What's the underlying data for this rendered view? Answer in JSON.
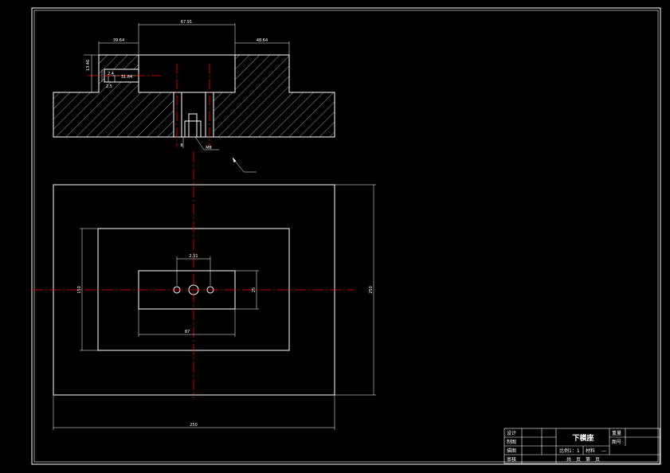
{
  "drawing": {
    "colors": {
      "background": "#000000",
      "line": "#ffffff",
      "centerline": "#ff0000"
    },
    "section_dims": {
      "top_width": "67.91",
      "left_shoulder": "39.64",
      "right_shoulder": "48.64",
      "left_height": "13.46",
      "pocket_depth": "31.64",
      "pocket_small": "2.4",
      "pocket_small_2": "2.5",
      "hole_small": "8",
      "thread_label": "M8"
    },
    "plan_dims": {
      "hole_spacing": "2.51",
      "inner_width": "87",
      "inner_height": "25",
      "middle_height": "150",
      "outer_height": "250",
      "outer_width": "250"
    },
    "title_block": {
      "title": "下模座",
      "rows": [
        "设计",
        "制图",
        "描图",
        "审核"
      ],
      "right_labels": [
        "重量",
        "图号"
      ],
      "scale_label": "比例1：1",
      "material_label": "材料",
      "material_value": "—",
      "sheets_label": "共　页　第　页"
    }
  }
}
